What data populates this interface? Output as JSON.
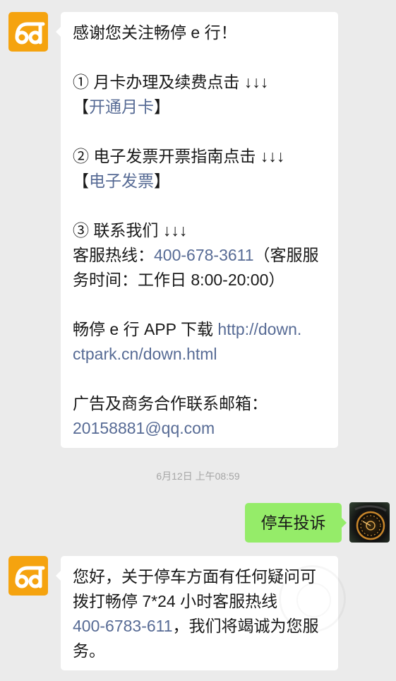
{
  "colors": {
    "background": "#ebebeb",
    "text": "#191919",
    "bubble_in": "#ffffff",
    "bubble_out": "#95ec69",
    "link": "#576b95",
    "timestamp": "#a6a6a6",
    "logo": "#f5a30f"
  },
  "icons": {
    "account_avatar": "changting-logo-icon",
    "user_avatar": "dashboard-photo"
  },
  "welcome_message": {
    "lines": [
      [
        {
          "text": "感谢您关注畅停 e 行！"
        }
      ],
      [],
      [
        {
          "text": "① 月卡办理及续费点击 ↓↓↓"
        }
      ],
      [
        {
          "text": "【"
        },
        {
          "text": "开通月卡",
          "link": true
        },
        {
          "text": "】"
        }
      ],
      [],
      [
        {
          "text": "② 电子发票开票指南点击 ↓↓↓"
        }
      ],
      [
        {
          "text": "【"
        },
        {
          "text": "电子发票",
          "link": true
        },
        {
          "text": "】"
        }
      ],
      [],
      [
        {
          "text": "③ 联系我们 ↓↓↓"
        }
      ],
      [
        {
          "text": "客服热线："
        },
        {
          "text": "400-678-3611",
          "link": true
        },
        {
          "text": "（客服服"
        }
      ],
      [
        {
          "text": "务时间：工作日 8:00-20:00）"
        }
      ],
      [],
      [
        {
          "text": "畅停 e 行 APP 下载 "
        },
        {
          "text": "http://down.",
          "link": true
        }
      ],
      [
        {
          "text": "ctpark.cn/down.html",
          "link": true
        }
      ],
      [],
      [
        {
          "text": "广告及商务合作联系邮箱："
        }
      ],
      [
        {
          "text": "20158881@qq.com",
          "link": true
        }
      ]
    ]
  },
  "timestamp": "6月12日 上午08:59",
  "sent_message": {
    "lines": [
      [
        {
          "text": "停车投诉"
        }
      ]
    ]
  },
  "reply_message": {
    "lines": [
      [
        {
          "text": "您好，关于停车方面有任何疑问可"
        }
      ],
      [
        {
          "text": "拨打畅停 7*24 小时客服热线"
        }
      ],
      [
        {
          "text": "400-6783-611",
          "link": true
        },
        {
          "text": "，我们将竭诚为您服"
        }
      ],
      [
        {
          "text": "务。"
        }
      ]
    ]
  }
}
